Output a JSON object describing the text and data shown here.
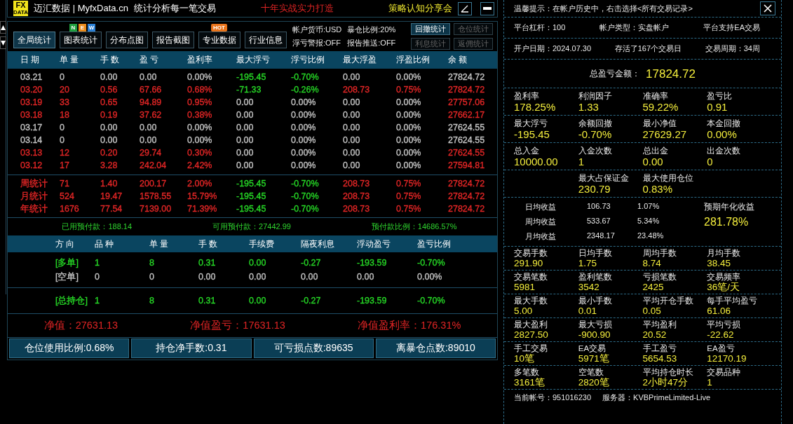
{
  "title_bar": {
    "logo": {
      "top": "FX",
      "bottom": "DATA"
    },
    "brand": "迈汇数据 | MyfxData.cn",
    "subtitle": "统计分析每一笔交易",
    "slogan": "十年实战实力打造",
    "promo": "策略认知分享会"
  },
  "toolbar": {
    "buttons": [
      {
        "label": "全局统计",
        "selected": true
      },
      {
        "label": "图表统计",
        "selected": false,
        "badge": {
          "kind": "letters",
          "letters": [
            {
              "text": "N",
              "color": "#1f9e3e"
            },
            {
              "text": "E",
              "color": "#e8891a"
            },
            {
              "text": "W",
              "color": "#2a7fd4"
            }
          ]
        }
      },
      {
        "label": "分布点图",
        "selected": false
      },
      {
        "label": "报告截图",
        "selected": false
      },
      {
        "label": "专业数据",
        "selected": false,
        "badge": {
          "kind": "tag",
          "text": "HOT"
        }
      },
      {
        "label": "行业信息",
        "selected": false
      }
    ],
    "info": [
      "帐户货币:USD",
      "暴仓比例:20%",
      "浮亏警报:OFF",
      "报告推送:OFF"
    ],
    "side_buttons": [
      {
        "label": "回撤统计",
        "disabled": false
      },
      {
        "label": "仓位统计",
        "disabled": true
      },
      {
        "label": "利息统计",
        "disabled": true
      },
      {
        "label": "返佣统计",
        "disabled": true
      }
    ]
  },
  "table": {
    "columns": [
      "日 期",
      "单 量",
      "手 数",
      "盈 亏",
      "盈利率",
      "最大浮亏",
      "浮亏比例",
      "最大浮盈",
      "浮盈比例",
      "余 额"
    ],
    "rows": [
      {
        "cells": [
          {
            "text": "03.21",
            "color": "#c4c4c4"
          },
          {
            "text": "0",
            "color": "#c4c4c4"
          },
          {
            "text": "0.00",
            "color": "#c4c4c4"
          },
          {
            "text": "0.00",
            "color": "#c4c4c4"
          },
          {
            "text": "0.00%",
            "color": "#c4c4c4"
          },
          {
            "text": "-195.45",
            "color": "#26d826"
          },
          {
            "text": "-0.70%",
            "color": "#26d826"
          },
          {
            "text": "0.00",
            "color": "#c4c4c4"
          },
          {
            "text": "0.00%",
            "color": "#c4c4c4"
          },
          {
            "text": "27824.72",
            "color": "#c4c4c4"
          }
        ]
      },
      {
        "cells": [
          {
            "text": "03.20",
            "color": "#e32626"
          },
          {
            "text": "20",
            "color": "#e32626"
          },
          {
            "text": "0.56",
            "color": "#e32626"
          },
          {
            "text": "67.66",
            "color": "#e32626"
          },
          {
            "text": "0.68%",
            "color": "#e32626"
          },
          {
            "text": "-71.33",
            "color": "#26d826"
          },
          {
            "text": "-0.26%",
            "color": "#26d826"
          },
          {
            "text": "208.73",
            "color": "#e32626"
          },
          {
            "text": "0.75%",
            "color": "#e32626"
          },
          {
            "text": "27824.72",
            "color": "#e32626"
          }
        ]
      },
      {
        "cells": [
          {
            "text": "03.19",
            "color": "#e32626"
          },
          {
            "text": "33",
            "color": "#e32626"
          },
          {
            "text": "0.65",
            "color": "#e32626"
          },
          {
            "text": "94.89",
            "color": "#e32626"
          },
          {
            "text": "0.95%",
            "color": "#e32626"
          },
          {
            "text": "0.00",
            "color": "#c4c4c4"
          },
          {
            "text": "0.00%",
            "color": "#c4c4c4"
          },
          {
            "text": "0.00",
            "color": "#c4c4c4"
          },
          {
            "text": "0.00%",
            "color": "#c4c4c4"
          },
          {
            "text": "27757.06",
            "color": "#e32626"
          }
        ]
      },
      {
        "cells": [
          {
            "text": "03.18",
            "color": "#e32626"
          },
          {
            "text": "18",
            "color": "#e32626"
          },
          {
            "text": "0.19",
            "color": "#e32626"
          },
          {
            "text": "37.62",
            "color": "#e32626"
          },
          {
            "text": "0.38%",
            "color": "#e32626"
          },
          {
            "text": "0.00",
            "color": "#c4c4c4"
          },
          {
            "text": "0.00%",
            "color": "#c4c4c4"
          },
          {
            "text": "0.00",
            "color": "#c4c4c4"
          },
          {
            "text": "0.00%",
            "color": "#c4c4c4"
          },
          {
            "text": "27662.17",
            "color": "#e32626"
          }
        ]
      },
      {
        "cells": [
          {
            "text": "03.17",
            "color": "#c4c4c4"
          },
          {
            "text": "0",
            "color": "#c4c4c4"
          },
          {
            "text": "0.00",
            "color": "#c4c4c4"
          },
          {
            "text": "0.00",
            "color": "#c4c4c4"
          },
          {
            "text": "0.00%",
            "color": "#c4c4c4"
          },
          {
            "text": "0.00",
            "color": "#c4c4c4"
          },
          {
            "text": "0.00%",
            "color": "#c4c4c4"
          },
          {
            "text": "0.00",
            "color": "#c4c4c4"
          },
          {
            "text": "0.00%",
            "color": "#c4c4c4"
          },
          {
            "text": "27624.55",
            "color": "#c4c4c4"
          }
        ]
      },
      {
        "cells": [
          {
            "text": "03.14",
            "color": "#c4c4c4"
          },
          {
            "text": "0",
            "color": "#c4c4c4"
          },
          {
            "text": "0.00",
            "color": "#c4c4c4"
          },
          {
            "text": "0.00",
            "color": "#c4c4c4"
          },
          {
            "text": "0.00%",
            "color": "#c4c4c4"
          },
          {
            "text": "0.00",
            "color": "#c4c4c4"
          },
          {
            "text": "0.00%",
            "color": "#c4c4c4"
          },
          {
            "text": "0.00",
            "color": "#c4c4c4"
          },
          {
            "text": "0.00%",
            "color": "#c4c4c4"
          },
          {
            "text": "27624.55",
            "color": "#c4c4c4"
          }
        ]
      },
      {
        "cells": [
          {
            "text": "03.13",
            "color": "#e32626"
          },
          {
            "text": "12",
            "color": "#e32626"
          },
          {
            "text": "0.20",
            "color": "#e32626"
          },
          {
            "text": "29.74",
            "color": "#e32626"
          },
          {
            "text": "0.30%",
            "color": "#e32626"
          },
          {
            "text": "0.00",
            "color": "#c4c4c4"
          },
          {
            "text": "0.00%",
            "color": "#c4c4c4"
          },
          {
            "text": "0.00",
            "color": "#c4c4c4"
          },
          {
            "text": "0.00%",
            "color": "#c4c4c4"
          },
          {
            "text": "27624.55",
            "color": "#e32626"
          }
        ]
      },
      {
        "cells": [
          {
            "text": "03.12",
            "color": "#e32626"
          },
          {
            "text": "17",
            "color": "#e32626"
          },
          {
            "text": "3.28",
            "color": "#e32626"
          },
          {
            "text": "242.04",
            "color": "#e32626"
          },
          {
            "text": "2.42%",
            "color": "#e32626"
          },
          {
            "text": "0.00",
            "color": "#c4c4c4"
          },
          {
            "text": "0.00%",
            "color": "#c4c4c4"
          },
          {
            "text": "0.00",
            "color": "#c4c4c4"
          },
          {
            "text": "0.00%",
            "color": "#c4c4c4"
          },
          {
            "text": "27594.81",
            "color": "#e32626"
          }
        ]
      }
    ],
    "summary_rows": [
      {
        "cells": [
          {
            "text": "周统计",
            "color": "#e32626"
          },
          {
            "text": "71",
            "color": "#e32626"
          },
          {
            "text": "1.40",
            "color": "#e32626"
          },
          {
            "text": "200.17",
            "color": "#e32626"
          },
          {
            "text": "2.00%",
            "color": "#e32626"
          },
          {
            "text": "-195.45",
            "color": "#26d826"
          },
          {
            "text": "-0.70%",
            "color": "#26d826"
          },
          {
            "text": "208.73",
            "color": "#e32626"
          },
          {
            "text": "0.75%",
            "color": "#e32626"
          },
          {
            "text": "27824.72",
            "color": "#e32626"
          }
        ]
      },
      {
        "cells": [
          {
            "text": "月统计",
            "color": "#e32626"
          },
          {
            "text": "524",
            "color": "#e32626"
          },
          {
            "text": "19.47",
            "color": "#e32626"
          },
          {
            "text": "1578.55",
            "color": "#e32626"
          },
          {
            "text": "15.79%",
            "color": "#e32626"
          },
          {
            "text": "-195.45",
            "color": "#26d826"
          },
          {
            "text": "-0.70%",
            "color": "#26d826"
          },
          {
            "text": "208.73",
            "color": "#e32626"
          },
          {
            "text": "0.75%",
            "color": "#e32626"
          },
          {
            "text": "27824.72",
            "color": "#e32626"
          }
        ]
      },
      {
        "cells": [
          {
            "text": "年统计",
            "color": "#e32626"
          },
          {
            "text": "1676",
            "color": "#e32626"
          },
          {
            "text": "77.54",
            "color": "#e32626"
          },
          {
            "text": "7139.00",
            "color": "#e32626"
          },
          {
            "text": "71.39%",
            "color": "#e32626"
          },
          {
            "text": "-195.45",
            "color": "#26d826"
          },
          {
            "text": "-0.70%",
            "color": "#26d826"
          },
          {
            "text": "208.73",
            "color": "#e32626"
          },
          {
            "text": "0.75%",
            "color": "#e32626"
          },
          {
            "text": "27824.72",
            "color": "#e32626"
          }
        ]
      }
    ]
  },
  "prepayment": [
    "已用预付款：188.14",
    "可用预付款：27442.99",
    "预付款比例：14686.57%"
  ],
  "positions": {
    "columns": [
      "方 向",
      "品 种",
      "单 量",
      "手 数",
      "手续费",
      "隔夜利息",
      "浮动盈亏",
      "盈亏比例"
    ],
    "rows": [
      {
        "cells": [
          {
            "text": "[多单]",
            "color": "#26d826"
          },
          {
            "text": "1",
            "color": "#26d826"
          },
          {
            "text": "8",
            "color": "#26d826"
          },
          {
            "text": "0.31",
            "color": "#26d826"
          },
          {
            "text": "0.00",
            "color": "#26d826"
          },
          {
            "text": "-0.27",
            "color": "#26d826"
          },
          {
            "text": "-193.59",
            "color": "#26d826"
          },
          {
            "text": "-0.70%",
            "color": "#26d826"
          }
        ]
      },
      {
        "cells": [
          {
            "text": "[空单]",
            "color": "#c4c4c4"
          },
          {
            "text": "0",
            "color": "#c4c4c4"
          },
          {
            "text": "0",
            "color": "#c4c4c4"
          },
          {
            "text": "0.00",
            "color": "#c4c4c4"
          },
          {
            "text": "0.00",
            "color": "#c4c4c4"
          },
          {
            "text": "0.00",
            "color": "#c4c4c4"
          },
          {
            "text": "0.00",
            "color": "#c4c4c4"
          },
          {
            "text": "0.00%",
            "color": "#c4c4c4"
          }
        ]
      }
    ],
    "total": {
      "cells": [
        {
          "text": "[总持仓]",
          "color": "#26d826"
        },
        {
          "text": "1",
          "color": "#26d826"
        },
        {
          "text": "8",
          "color": "#26d826"
        },
        {
          "text": "0.31",
          "color": "#26d826"
        },
        {
          "text": "0.00",
          "color": "#26d826"
        },
        {
          "text": "-0.27",
          "color": "#26d826"
        },
        {
          "text": "-193.59",
          "color": "#26d826"
        },
        {
          "text": "-0.70%",
          "color": "#26d826"
        }
      ]
    }
  },
  "equity": [
    "净值：27631.13",
    "净值盈亏：17631.13",
    "净值盈利率：176.31%"
  ],
  "footer_boxes": [
    "仓位使用比例:0.68%",
    "持仓净手数:0.31",
    "可亏损点数:89635",
    "离暴仓点数:89010"
  ],
  "side_panel": {
    "tip": "温馨提示：在帐户历史中，右击选择<所有交易记录>",
    "account_rows": [
      [
        "平台杠杆：100",
        "帐户类型：实盘帐户",
        "平台支持EA交易"
      ],
      [
        "开户日期：2024.07.30",
        "存活了167个交易日",
        "交易周期：34周"
      ]
    ],
    "total": {
      "label": "总盈亏金额：",
      "value": "17824.72"
    },
    "groups_a": [
      [
        {
          "label": "盈利率",
          "value": "178.25%"
        },
        {
          "label": "利润因子",
          "value": "1.33"
        },
        {
          "label": "准确率",
          "value": "59.22%"
        },
        {
          "label": "盈亏比",
          "value": "0.91"
        }
      ],
      [
        {
          "label": "最大浮亏",
          "value": "-195.45"
        },
        {
          "label": "余额回撤",
          "value": "-0.70%"
        },
        {
          "label": "最小净值",
          "value": "27629.27"
        },
        {
          "label": "本金回撤",
          "value": "0.00%"
        }
      ],
      [
        {
          "label": "总入金",
          "value": "10000.00"
        },
        {
          "label": "入金次数",
          "value": "1"
        },
        {
          "label": "总出金",
          "value": "0.00"
        },
        {
          "label": "出金次数",
          "value": "0"
        }
      ],
      [
        {
          "label": "最大占保证金",
          "value": "230.79"
        },
        {
          "label": "最大使用仓位",
          "value": "0.83%"
        }
      ]
    ],
    "averages": [
      [
        "日均收益",
        "106.73",
        "1.07%"
      ],
      [
        "周均收益",
        "533.67",
        "5.34%"
      ],
      [
        "月均收益",
        "2348.17",
        "23.48%"
      ]
    ],
    "annualized": {
      "label": "预期年化收益",
      "value": "281.78%"
    },
    "groups_b": [
      [
        {
          "label": "交易手数",
          "value": "291.90"
        },
        {
          "label": "日均手数",
          "value": "1.75"
        },
        {
          "label": "周均手数",
          "value": "8.74"
        },
        {
          "label": "月均手数",
          "value": "38.45"
        }
      ],
      [
        {
          "label": "交易笔数",
          "value": "5981"
        },
        {
          "label": "盈利笔数",
          "value": "3542"
        },
        {
          "label": "亏损笔数",
          "value": "2425"
        },
        {
          "label": "交易频率",
          "value": "36笔/天"
        }
      ],
      [
        {
          "label": "最大手数",
          "value": "5.00"
        },
        {
          "label": "最小手数",
          "value": "0.01"
        },
        {
          "label": "平均开仓手数",
          "value": "0.05"
        },
        {
          "label": "每手平均盈亏",
          "value": "61.06"
        }
      ],
      [
        {
          "label": "最大盈利",
          "value": "2827.50"
        },
        {
          "label": "最大亏损",
          "value": "-900.90"
        },
        {
          "label": "平均盈利",
          "value": "20.52"
        },
        {
          "label": "平均亏损",
          "value": "-22.62"
        }
      ],
      [
        {
          "label": "手工交易",
          "value": "10笔"
        },
        {
          "label": "EA交易",
          "value": "5971笔"
        },
        {
          "label": "手工盈亏",
          "value": "5654.53"
        },
        {
          "label": "EA盈亏",
          "value": "12170.19"
        }
      ],
      [
        {
          "label": "多笔数",
          "value": "3161笔"
        },
        {
          "label": "空笔数",
          "value": "2820笔"
        },
        {
          "label": "平均持仓时长",
          "value": "2小时47分"
        },
        {
          "label": "交易品种",
          "value": "1"
        }
      ]
    ],
    "footer": [
      "当前帐号：951016230",
      "服务器：KVBPrimeLimited-Live"
    ]
  }
}
